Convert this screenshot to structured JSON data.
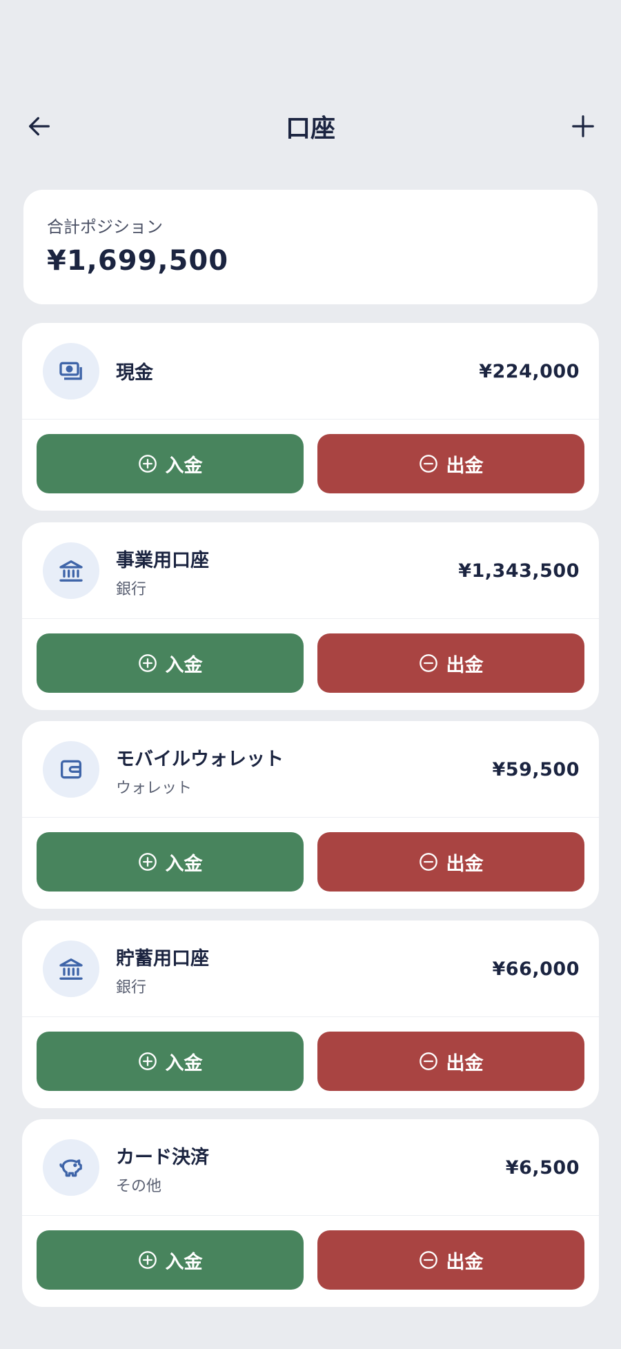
{
  "header": {
    "title": "口座"
  },
  "total": {
    "label": "合計ポジション",
    "value": "¥1,699,500"
  },
  "accounts": [
    {
      "name": "現金",
      "type": "",
      "amount": "¥224,000",
      "icon": "cash-icon"
    },
    {
      "name": "事業用口座",
      "type": "銀行",
      "amount": "¥1,343,500",
      "icon": "bank-icon"
    },
    {
      "name": "モバイルウォレット",
      "type": "ウォレット",
      "amount": "¥59,500",
      "icon": "wallet-icon"
    },
    {
      "name": "貯蓄用口座",
      "type": "銀行",
      "amount": "¥66,000",
      "icon": "bank-icon"
    },
    {
      "name": "カード決済",
      "type": "その他",
      "amount": "¥6,500",
      "icon": "piggy-bank-icon"
    }
  ],
  "actions": {
    "deposit": "入金",
    "withdraw": "出金"
  },
  "colors": {
    "background": "#e9ebef",
    "deposit": "#48845d",
    "withdraw": "#a94442",
    "icon": "#3e64a8",
    "icon_bg": "#e8eef8",
    "text": "#1b2440"
  }
}
